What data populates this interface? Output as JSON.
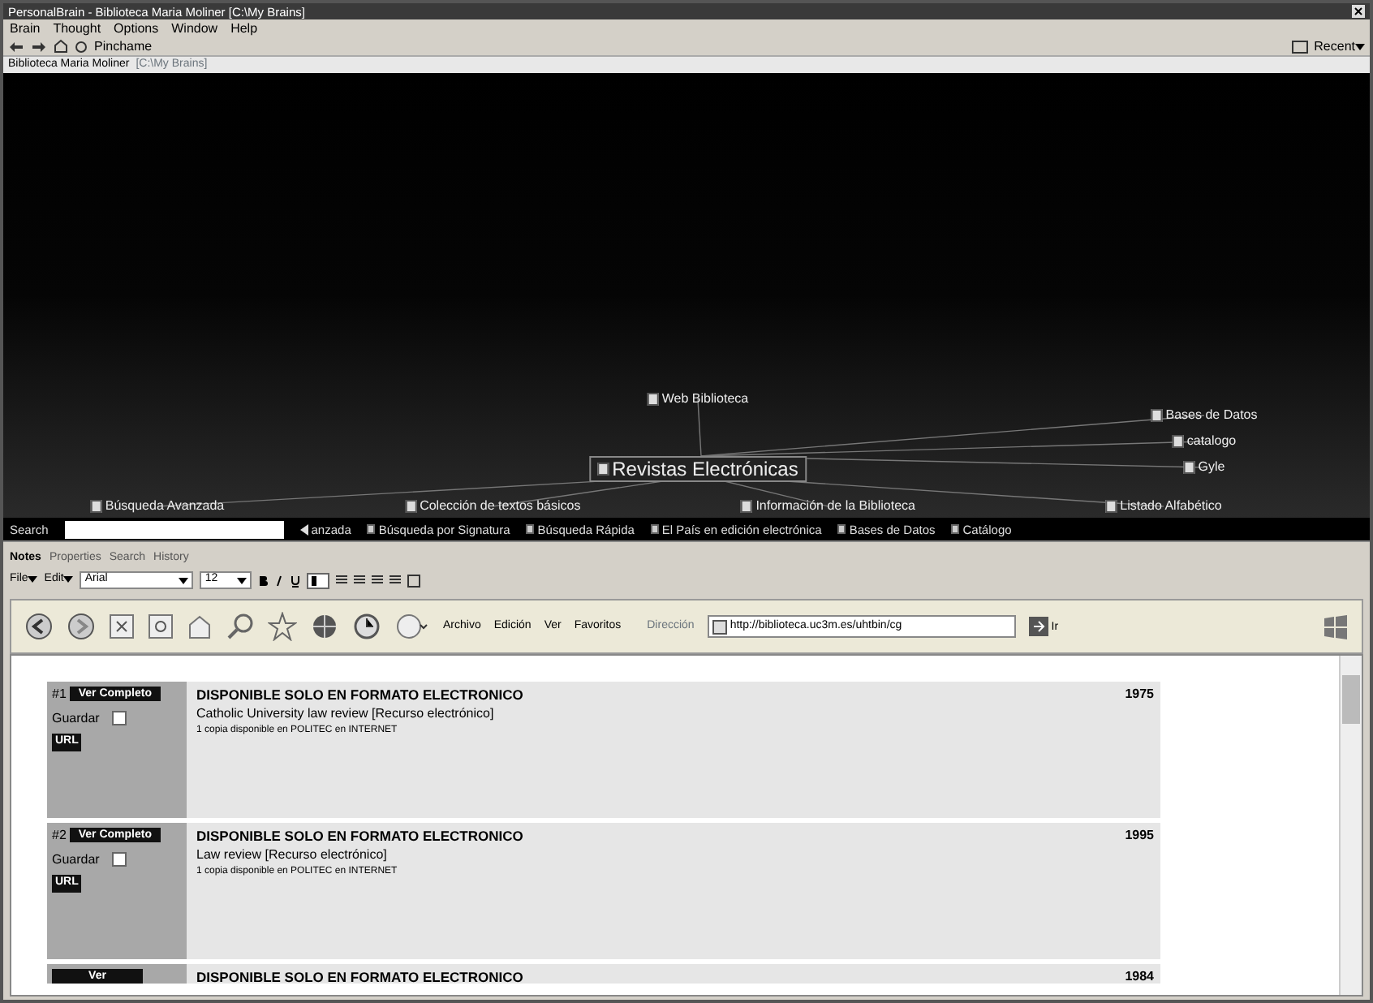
{
  "window": {
    "title": "PersonalBrain - Biblioteca Maria Moliner [C:\\My Brains]"
  },
  "menu": [
    "Brain",
    "Thought",
    "Options",
    "Window",
    "Help"
  ],
  "toolbar": {
    "pin": "Pinchame",
    "recent": "Recent"
  },
  "address_bar": {
    "path": "Biblioteca Maria Moliner",
    "hint": "[C:\\My Brains]"
  },
  "plex": {
    "nodes": [
      {
        "kind": "parent",
        "label": "Web Biblioteca"
      },
      {
        "kind": "central",
        "label": "Revistas Electrónicas"
      },
      {
        "kind": "jump",
        "label": "Bases de Datos"
      },
      {
        "kind": "jump",
        "label": "catalogo"
      },
      {
        "kind": "jump",
        "label": "Gyle"
      },
      {
        "kind": "child",
        "label": "Búsqueda Avanzada"
      },
      {
        "kind": "child",
        "label": "Colección de textos básicos"
      },
      {
        "kind": "child",
        "label": "Información de la Biblioteca"
      },
      {
        "kind": "child",
        "label": "Listado Alfabético"
      }
    ]
  },
  "search": {
    "label": "Search"
  },
  "pins": [
    {
      "label": "anzada",
      "arrow": true
    },
    {
      "label": "Búsqueda por Signatura"
    },
    {
      "label": "Búsqueda Rápida"
    },
    {
      "label": "El País en edición electrónica"
    },
    {
      "label": "Bases de Datos"
    },
    {
      "label": "Catálogo"
    }
  ],
  "pane_tabs": [
    {
      "label": "Notes",
      "selected": true
    },
    {
      "label": "Properties",
      "selected": false
    },
    {
      "label": "Search",
      "selected": false
    },
    {
      "label": "History",
      "selected": false
    }
  ],
  "format_bar": {
    "file": "File",
    "edit": "Edit",
    "font": "Arial",
    "size": "12"
  },
  "browser": {
    "menu": [
      "Archivo",
      "Edición",
      "Ver",
      "Favoritos"
    ],
    "address_label": "Dirección",
    "address": "http://biblioteca.uc3m.es/uhtbin/cg",
    "go": "Ir"
  },
  "records": [
    {
      "number": "#1",
      "view": "Ver Completo",
      "save": "Guardar",
      "checked": false,
      "url": "URL",
      "heading": "DISPONIBLE SOLO EN FORMATO ELECTRONICO",
      "title": "Catholic University law review [Recurso electrónico]",
      "copies": "1 copia disponible en POLITEC en INTERNET",
      "year": "1975"
    },
    {
      "number": "#2",
      "view": "Ver Completo",
      "save": "Guardar",
      "checked": false,
      "url": "URL",
      "heading": "DISPONIBLE SOLO EN FORMATO ELECTRONICO",
      "title": "Law review [Recurso electrónico]",
      "copies": "1 copia disponible en POLITEC en INTERNET",
      "year": "1995"
    },
    {
      "view": "Ver",
      "heading": "DISPONIBLE SOLO EN FORMATO ELECTRONICO",
      "year": "1984"
    }
  ]
}
